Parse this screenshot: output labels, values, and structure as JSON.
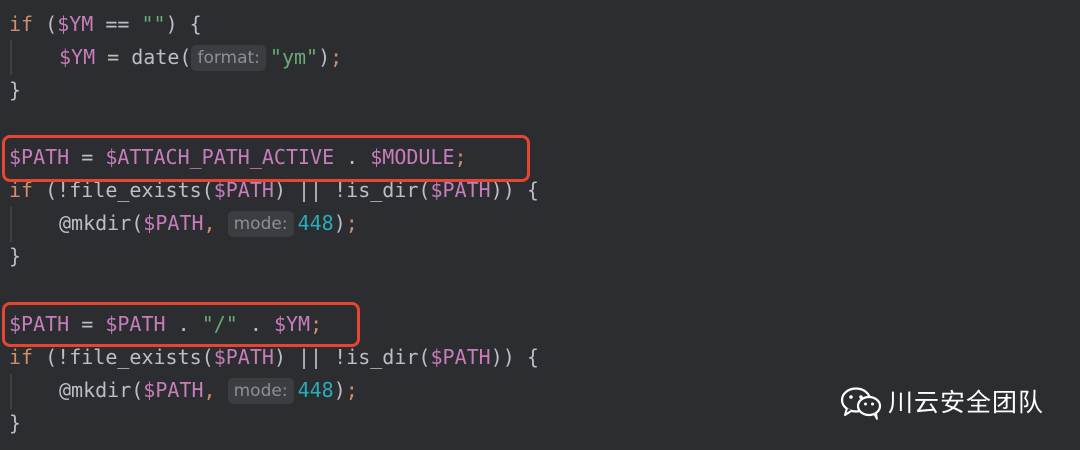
{
  "editor": {
    "lines": {
      "l1": {
        "kw_if": "if",
        "open": " (",
        "var": "$YM",
        "op": " == ",
        "str": "\"\"",
        "close": ") {"
      },
      "l2": {
        "var": "$YM",
        "op": " = ",
        "fn": "date(",
        "hint": "format:",
        "str": "\"ym\"",
        "close": ")",
        "semi": ";"
      },
      "l3": {
        "brace": "}"
      },
      "l5": {
        "var1": "$PATH",
        "op1": " = ",
        "var2": "$ATTACH_PATH_ACTIVE",
        "op2": " . ",
        "var3": "$MODULE",
        "semi": ";"
      },
      "l6": {
        "kw_if": "if",
        "p1": " (!file_exists(",
        "var1": "$PATH",
        "p2": ") || !is_dir(",
        "var2": "$PATH",
        "p3": ")) {"
      },
      "l7": {
        "fn": "@mkdir(",
        "var": "$PATH",
        "comma": ",",
        "hint": "mode:",
        "num": "448",
        "close": ")",
        "semi": ";"
      },
      "l8": {
        "brace": "}"
      },
      "l10": {
        "var1": "$PATH",
        "op1": " = ",
        "var2": "$PATH",
        "op2": " . ",
        "str": "\"/\"",
        "op3": " . ",
        "var3": "$YM",
        "semi": ";"
      },
      "l11": {
        "kw_if": "if",
        "p1": " (!file_exists(",
        "var1": "$PATH",
        "p2": ") || !is_dir(",
        "var2": "$PATH",
        "p3": ")) {"
      },
      "l12": {
        "fn": "@mkdir(",
        "var": "$PATH",
        "comma": ",",
        "hint": "mode:",
        "num": "448",
        "close": ")",
        "semi": ";"
      },
      "l13": {
        "brace": "}"
      }
    }
  },
  "highlight_color": "#e64532",
  "watermark": {
    "text": "川云安全团队",
    "icon": "wechat-icon"
  }
}
